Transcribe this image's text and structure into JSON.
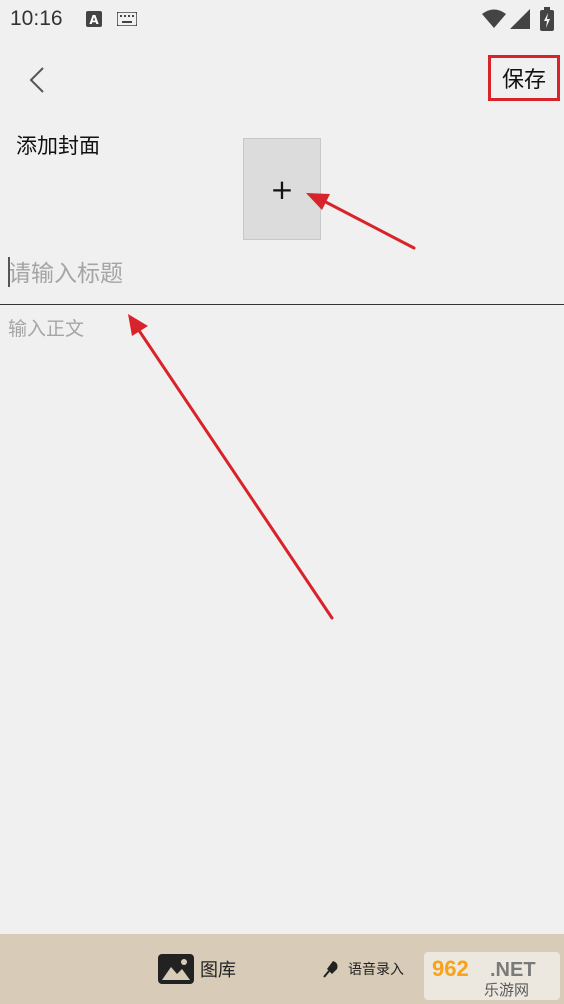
{
  "status_bar": {
    "time": "10:16",
    "icons": [
      "a-notification-icon",
      "keyboard-icon",
      "wifi-icon",
      "signal-icon",
      "battery-icon"
    ]
  },
  "toolbar": {
    "back_icon": "chevron-left-icon",
    "save_label": "保存",
    "highlight_color": "#d9232b"
  },
  "cover": {
    "label": "添加封面",
    "add_symbol": "+"
  },
  "title_input": {
    "placeholder": "请输入标题",
    "value": ""
  },
  "body_input": {
    "placeholder": "输入正文",
    "value": ""
  },
  "bottom_bar": {
    "gallery_label": "图库",
    "gallery_icon": "image-icon",
    "voice_label": "语音录入",
    "voice_icon": "microphone-icon",
    "background": "#d8ccb8"
  },
  "watermark": {
    "top_text": "962.NET",
    "bottom_text": "乐游网"
  },
  "annotations": {
    "arrow_color": "#d9232b"
  }
}
